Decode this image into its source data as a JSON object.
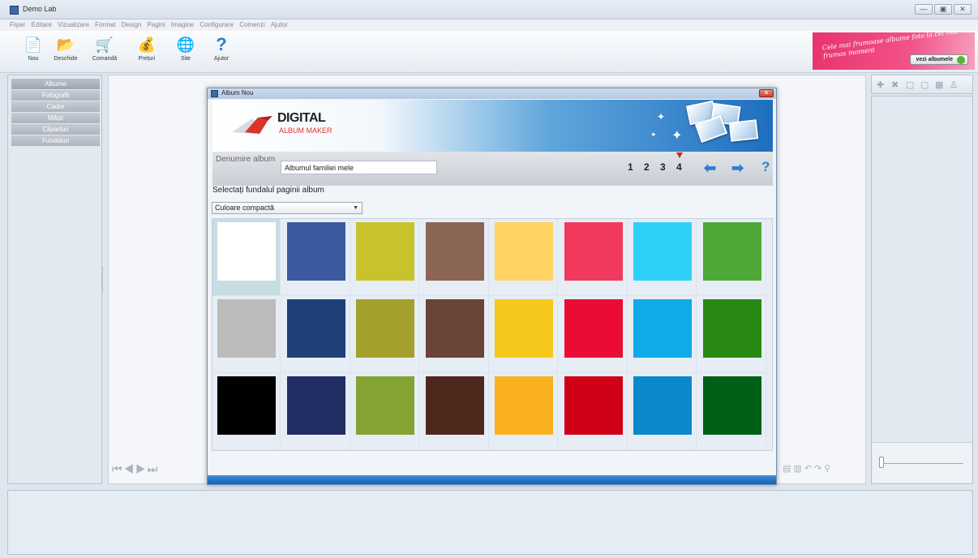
{
  "window": {
    "title": "Demo Lab",
    "controls": [
      "—",
      "▣",
      "✕"
    ]
  },
  "menu": [
    "Fișier",
    "Editare",
    "Vizualizare",
    "Format",
    "Design",
    "Pagini",
    "Imagine",
    "Configurare",
    "Comenzi",
    "Ajutor"
  ],
  "toolbar": [
    {
      "label": "Nou",
      "icon": "new-document-icon",
      "glyph": "📄"
    },
    {
      "label": "Deschide",
      "icon": "open-folder-icon",
      "glyph": "📂"
    },
    {
      "label": "Comandă",
      "icon": "cart-icon",
      "glyph": "🛒"
    },
    {
      "label": "Prețuri",
      "icon": "money-icon",
      "glyph": "💰"
    },
    {
      "label": "Site",
      "icon": "globe-icon",
      "glyph": "🌐"
    },
    {
      "label": "Ajutor",
      "icon": "help-icon",
      "glyph": "?"
    }
  ],
  "promo": {
    "text": "Cele mai frumoase albume foto la cel mai frumos moment",
    "button": "vezi albumele"
  },
  "left_panel": {
    "items": [
      "Albume",
      "Fotografii",
      "Cadre",
      "Măști",
      "Cliparturi",
      "Fundaluri"
    ]
  },
  "dialog": {
    "title": "Album Nou",
    "logo": {
      "title": "DIGITAL",
      "subtitle": "ALBUM MAKER"
    },
    "name_label": "Denumire album",
    "name_value": "Albumul familiei mele",
    "steps": [
      "1",
      "2",
      "3",
      "4"
    ],
    "current_step": "4",
    "select_label": "Selectați fundalul paginii album",
    "select_value": "Culoare compactă",
    "swatches": [
      [
        "#ffffff",
        "#3c5aa0",
        "#c8c22d",
        "#8b6553",
        "#ffd465",
        "#f23a5e",
        "#2fd0f8",
        "#4ea836"
      ],
      [
        "#bbbbbb",
        "#1d4078",
        "#a4a02c",
        "#6a4436",
        "#f7c81c",
        "#ea0c33",
        "#10aae8",
        "#288a12"
      ],
      [
        "#000000",
        "#222d63",
        "#83a432",
        "#4e281c",
        "#f9b21d",
        "#d00018",
        "#0b88cb",
        "#006015"
      ]
    ]
  }
}
